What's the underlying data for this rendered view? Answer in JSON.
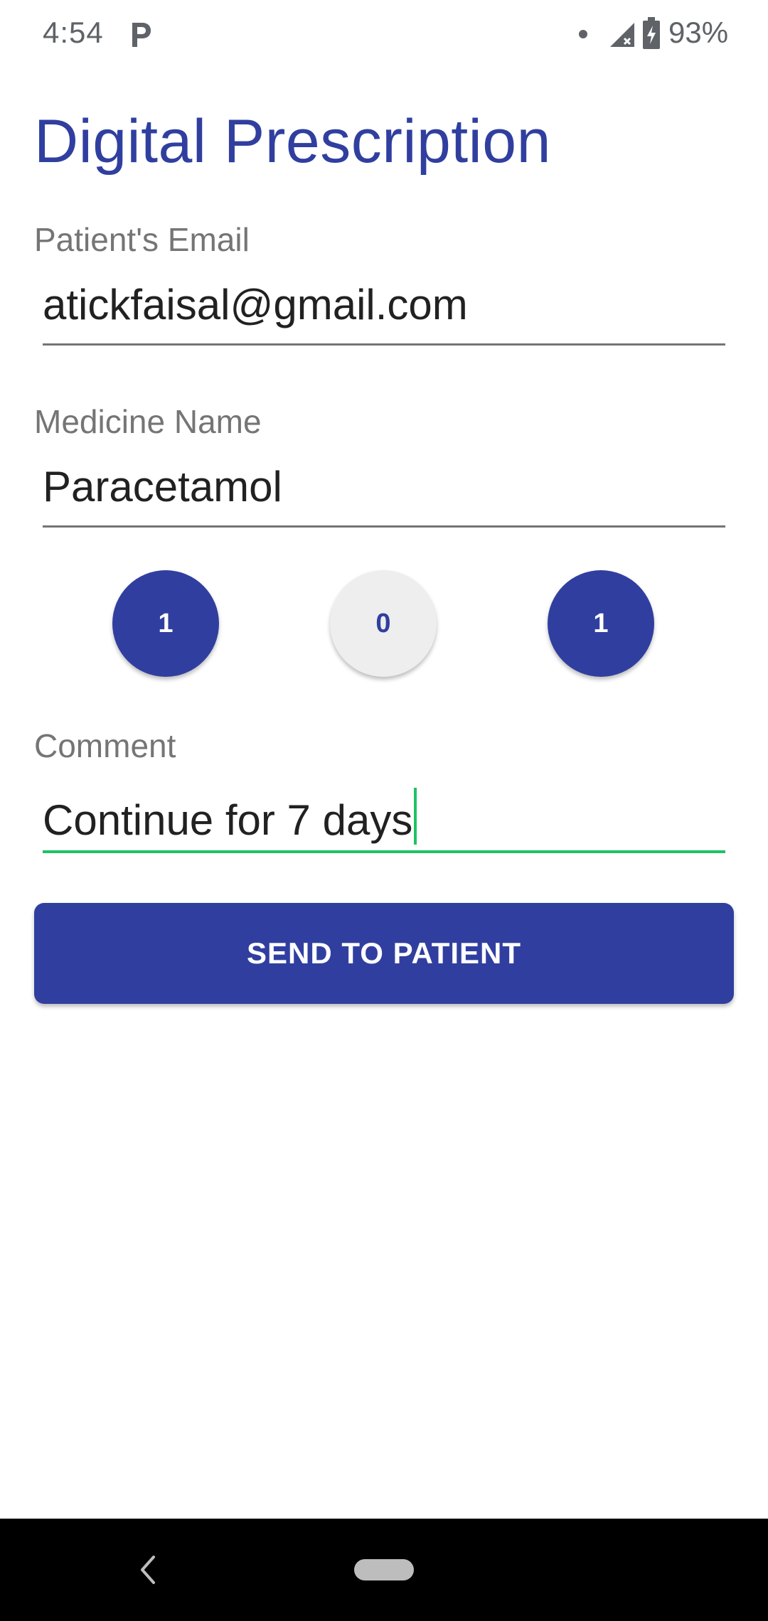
{
  "status_bar": {
    "time": "4:54",
    "battery": "93%",
    "icons": [
      "parking-icon",
      "notification-dot-icon",
      "signal-icon",
      "battery-charging-icon"
    ]
  },
  "title": "Digital Prescription",
  "form": {
    "email": {
      "label": "Patient's Email",
      "value": "atickfaisal@gmail.com"
    },
    "medicine": {
      "label": "Medicine Name",
      "value": "Paracetamol"
    },
    "doses": [
      {
        "value": "1",
        "state": "on"
      },
      {
        "value": "0",
        "state": "off"
      },
      {
        "value": "1",
        "state": "on"
      }
    ],
    "comment": {
      "label": "Comment",
      "value": "Continue for 7 days"
    },
    "send_label": "SEND TO PATIENT"
  },
  "colors": {
    "primary": "#303f9f",
    "focus_line": "#1ec264",
    "label": "#757575",
    "inactive_dose": "#eeeeee"
  }
}
